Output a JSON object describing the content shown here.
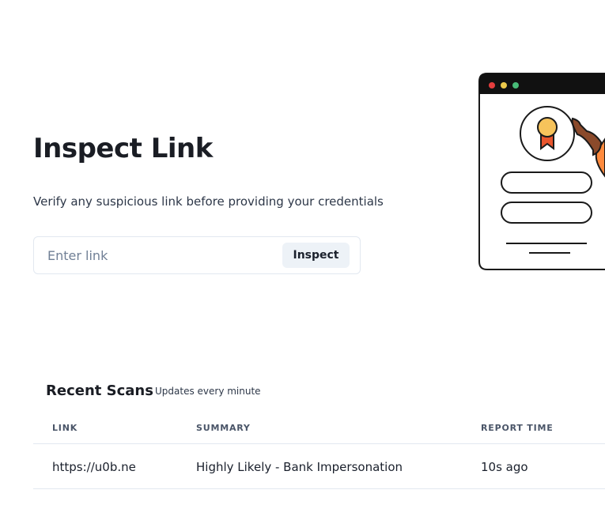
{
  "header": {
    "title": "Inspect Link",
    "subtitle": "Verify any suspicious link before providing your credentials"
  },
  "search": {
    "placeholder": "Enter link",
    "value": "",
    "button_label": "Inspect"
  },
  "illustration": {
    "icon": "certificate-document-illustration",
    "dot_colors": [
      "#e53e3e",
      "#ecc94b",
      "#48bb78"
    ],
    "accent_colors": [
      "#f6c35b",
      "#e8552d",
      "#ff8a3d",
      "#8b4a2b"
    ]
  },
  "recent_scans": {
    "title": "Recent Scans",
    "note": "Updates every minute",
    "columns": [
      "LINK",
      "SUMMARY",
      "REPORT TIME"
    ],
    "rows": [
      {
        "link": "https://u0b.ne",
        "summary": "Highly Likely - Bank Impersonation",
        "report_time": "10s ago"
      }
    ]
  }
}
